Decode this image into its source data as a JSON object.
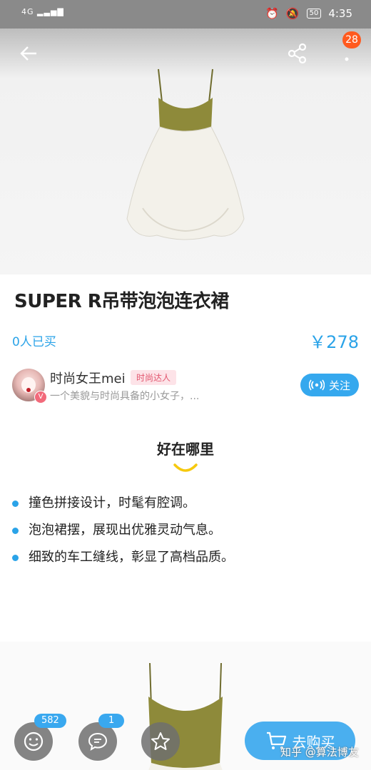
{
  "status_bar": {
    "network": "4G",
    "battery": "50",
    "time": "4:35"
  },
  "header": {
    "badge_count": "28"
  },
  "product": {
    "title": "SUPER R吊带泡泡连衣裙",
    "bought": "0人已买",
    "price": "￥278"
  },
  "author": {
    "name": "时尚女王mei",
    "tag": "时尚达人",
    "desc": "一个美貌与时尚具备的小女子，...",
    "follow_label": "关注",
    "verified_mark": "V"
  },
  "highlights": {
    "title": "好在哪里",
    "items": [
      "撞色拼接设计，时髦有腔调。",
      "泡泡裙摆，展现出优雅灵动气息。",
      "细致的车工缝线，彰显了高档品质。"
    ]
  },
  "bottom_bar": {
    "emoji_count": "582",
    "comment_count": "1",
    "buy_label": "去购买"
  },
  "watermark": "知乎 @算法博友",
  "colors": {
    "accent": "#2aa3e8",
    "badge": "#ff5a1f",
    "dress_bodice": "#8e8a3a",
    "dress_skirt": "#f3f1ea"
  }
}
